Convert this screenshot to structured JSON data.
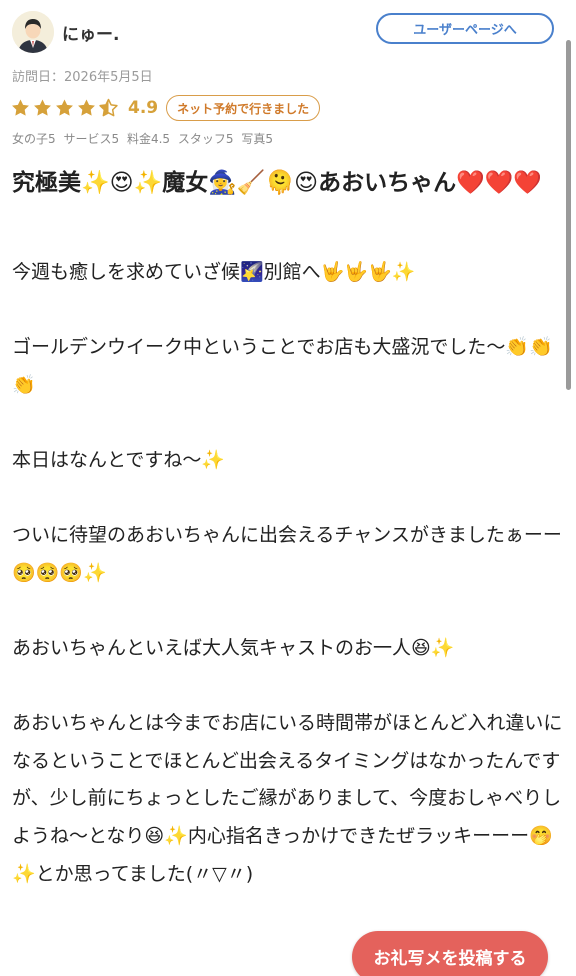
{
  "user": {
    "name": "にゅー.",
    "profile_button": "ユーザーページへ"
  },
  "review": {
    "visit_date": "訪問日：2026年5月5日",
    "rating": 4.9,
    "rating_text": "4.9",
    "stars_filled": 4.5,
    "booking_badge": "ネット予約で行きました",
    "sub_scores": [
      "女の子5",
      "サービス5",
      "料金4.5",
      "スタッフ5",
      "写真5"
    ],
    "title": "究極美✨😍✨魔女🧙‍♀️🧹🫠😍あおいちゃん❤️❤️❤️",
    "body": [
      "今週も癒しを求めていざ候🌠別館へ🤟🤟🤟✨",
      "",
      "ゴールデンウイーク中ということでお店も大盛況でした〜👏👏👏",
      "",
      "本日はなんとですね〜✨",
      "",
      "ついに待望のあおいちゃんに出会えるチャンスがきましたぁーー🥺🥺🥺✨",
      "",
      "あおいちゃんといえば大人気キャストのお一人😆✨",
      "",
      "あおいちゃんとは今までお店にいる時間帯がほとんど入れ違いになるということでほとんど出会えるタイミングはなかったんですが、少し前にちょっとしたご縁がありまして、今度おしゃべりしようね〜となり😆✨内心指名きっかけできたぜラッキーーー🤭✨とか思ってました(〃▽〃)"
    ]
  },
  "cta": {
    "label": "お礼写メを投稿する"
  },
  "colors": {
    "accent_blue": "#4a80cc",
    "star_gold": "#d6a13a",
    "badge_orange": "#d07a2a",
    "cta_red": "#e4625c"
  }
}
